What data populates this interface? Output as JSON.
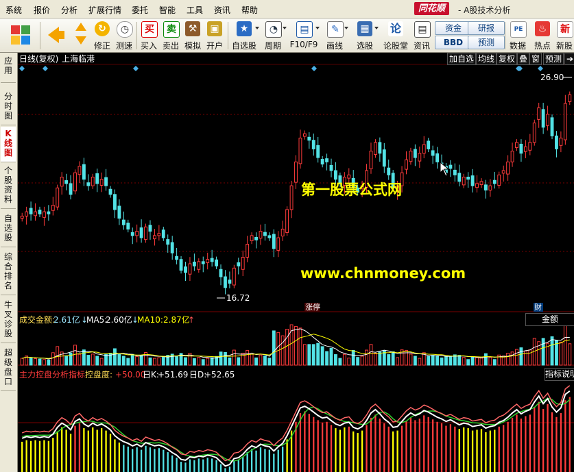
{
  "menu": [
    "系统",
    "报价",
    "分析",
    "扩展行情",
    "委托",
    "智能",
    "工具",
    "资讯",
    "帮助"
  ],
  "brand": "同花顺",
  "app_subtitle": "- A股技术分析",
  "toolbar": {
    "back_label": "",
    "fix_label": "修正",
    "test_label": "测速",
    "buy_icon": "买",
    "buy_label": "买入",
    "sell_icon": "卖",
    "sell_label": "卖出",
    "sim_label": "模拟",
    "open_label": "开户",
    "watchlist_label": "自选股",
    "period_label": "周期",
    "f10_label": "F10/F9",
    "draw_label": "画线",
    "select_label": "选股",
    "forum_label": "论股堂",
    "news_label": "资讯",
    "fund_btn": "资金",
    "research_btn": "研报",
    "bbd_btn": "BBD",
    "forecast_btn": "预测",
    "data_label": "数据",
    "hot_label": "热点",
    "newstock_label": "新股"
  },
  "side_tabs": [
    {
      "label": "应用"
    },
    {
      "label": "分时图"
    },
    {
      "label": "K线图"
    },
    {
      "label": "个股资料"
    },
    {
      "label": "自选股"
    },
    {
      "label": "综合排名"
    },
    {
      "label": "牛叉诊股"
    },
    {
      "label": "超级盘口"
    }
  ],
  "chart_header": {
    "period": "日线(复权)",
    "stock": "上海临港",
    "btn_add": "加自选",
    "btn_ma": "均线",
    "btn_adj": "复权",
    "btn_overlay": "叠",
    "btn_window": "窗",
    "btn_predict": "预测"
  },
  "watermark": {
    "line1": "第一股票公式网",
    "line2": "www.chnmoney.com"
  },
  "price_pane": {
    "high_label": "26.90",
    "low_label": "16.72",
    "event1": "涨停",
    "event2": "财"
  },
  "volume_pane": {
    "label": "成交金额:",
    "value": "2.61亿",
    "ma5_label": "MA5:",
    "ma5_value": "2.60亿",
    "ma10_label": "MA10:",
    "ma10_value": "2.87亿",
    "button": "金额"
  },
  "indicator_pane": {
    "name": "主力控盘分析指标",
    "ctrl_label": "控盘度:",
    "ctrl_value": "+50.00",
    "k_label": "日K:",
    "k_value": "+51.69",
    "d_label": "日D:",
    "d_value": "+52.65",
    "button": "指标说明"
  },
  "colors": {
    "up": "#ff3b3b",
    "down": "#53e3e6",
    "ma_white": "#ffffff",
    "ma_yellow": "#ffff00",
    "ma_green": "#2fd02f",
    "grid": "#7a0000",
    "watermark": "#ffff00"
  },
  "chart_data": {
    "type": "candlestick",
    "stock": "上海临港",
    "period": "日线(复权)",
    "price_range": [
      16.72,
      26.9
    ],
    "high": 26.9,
    "low": 16.72,
    "close": [
      20.5,
      20.7,
      20.6,
      20.7,
      20.6,
      20.7,
      20.6,
      21.0,
      21.8,
      22.3,
      22.0,
      21.5,
      22.5,
      22.8,
      22.2,
      21.9,
      22.3,
      22.0,
      22.2,
      21.9,
      21.5,
      20.8,
      20.4,
      20.1,
      19.9,
      19.6,
      19.8,
      19.5,
      20.0,
      19.8,
      19.6,
      19.7,
      19.5,
      19.2,
      18.8,
      18.5,
      18.0,
      17.9,
      18.3,
      18.2,
      18.4,
      18.3,
      18.5,
      18.4,
      18.2,
      17.7,
      17.2,
      17.4,
      18.1,
      18.2,
      18.6,
      19.2,
      19.6,
      19.4,
      19.8,
      19.6,
      19.5,
      19.0,
      19.5,
      19.9,
      20.8,
      21.9,
      23.0,
      24.1,
      24.3,
      24.0,
      23.6,
      23.2,
      22.9,
      23.0,
      22.6,
      22.2,
      22.0,
      22.3,
      22.4,
      21.8,
      21.6,
      21.9,
      22.6,
      23.5,
      23.9,
      23.4,
      22.8,
      22.4,
      21.8,
      21.9,
      22.5,
      23.1,
      23.5,
      23.2,
      23.4,
      23.8,
      23.6,
      23.3,
      23.0,
      22.8,
      22.5,
      22.7,
      22.4,
      22.1,
      22.3,
      22.2,
      21.9,
      22.0,
      22.1,
      21.7,
      21.9,
      22.0,
      22.4,
      22.6,
      23.0,
      23.5,
      23.9,
      23.4,
      23.7,
      23.9,
      24.8,
      25.5,
      24.6,
      25.2,
      24.2,
      23.6,
      24.1,
      25.7,
      26.1
    ],
    "volume_unit": "亿",
    "volume_last": 2.61,
    "volume_ma5": 2.6,
    "volume_ma10": 2.87,
    "indicator": "主力控盘分析指标",
    "indicator_values": {
      "控盘度": 50.0,
      "日K": 51.69,
      "日D": 52.65
    }
  }
}
